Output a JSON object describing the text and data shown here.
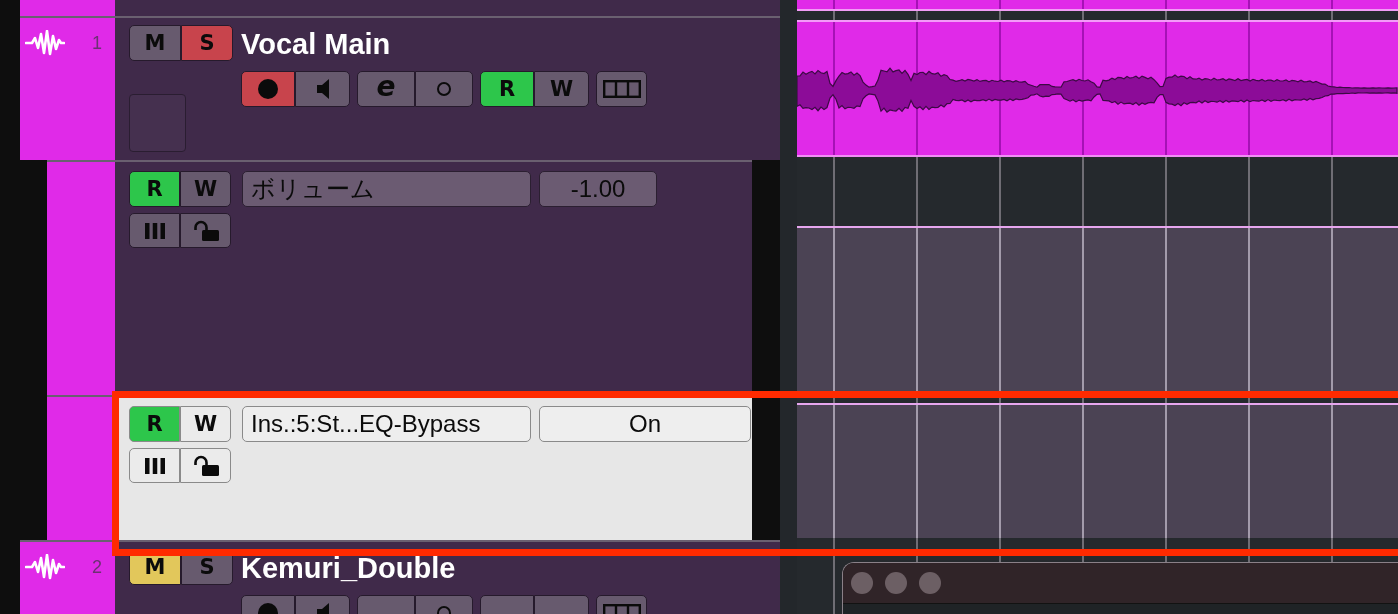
{
  "track_headers": [
    {
      "number": "1",
      "name": "Vocal Main",
      "mute": {
        "label": "M",
        "on": false
      },
      "solo": {
        "label": "S",
        "on": true
      },
      "record_enabled": true,
      "monitor": false,
      "edit_label": "e",
      "read": {
        "label": "R",
        "on": true
      },
      "write": {
        "label": "W",
        "on": false
      },
      "clip": {
        "kind": "audio"
      },
      "automation_lanes": [
        {
          "kind": "numeric",
          "read": {
            "label": "R",
            "on": true
          },
          "write": {
            "label": "W",
            "on": false
          },
          "parameter": "ボリューム",
          "value": "-1.00",
          "selected": false,
          "highlighted": false
        },
        {
          "kind": "switch",
          "read": {
            "label": "R",
            "on": true
          },
          "write": {
            "label": "W",
            "on": false
          },
          "parameter": "Ins.:5:St...EQ-Bypass",
          "value": "On",
          "selected": true,
          "highlighted": true
        }
      ]
    },
    {
      "number": "2",
      "name": "Kemuri_Double",
      "mute": {
        "label": "M",
        "on": true
      },
      "solo": {
        "label": "S",
        "on": false
      },
      "record_enabled": false,
      "monitor": false,
      "read": {
        "on": false
      },
      "write": {
        "on": false
      }
    }
  ],
  "floating_window": {
    "active": false
  }
}
